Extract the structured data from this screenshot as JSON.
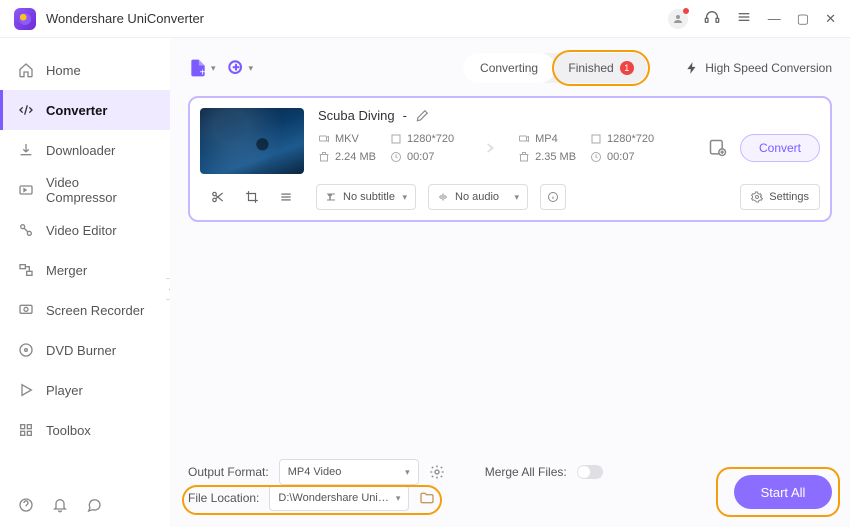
{
  "app": {
    "title": "Wondershare UniConverter"
  },
  "sidebar": {
    "items": [
      {
        "label": "Home"
      },
      {
        "label": "Converter"
      },
      {
        "label": "Downloader"
      },
      {
        "label": "Video Compressor"
      },
      {
        "label": "Video Editor"
      },
      {
        "label": "Merger"
      },
      {
        "label": "Screen Recorder"
      },
      {
        "label": "DVD Burner"
      },
      {
        "label": "Player"
      },
      {
        "label": "Toolbox"
      }
    ]
  },
  "tabs": {
    "converting": "Converting",
    "finished": "Finished",
    "finished_count": "1"
  },
  "hsc": "High Speed Conversion",
  "item": {
    "title": "Scuba Diving",
    "dash": "-",
    "src": {
      "format": "MKV",
      "resolution": "1280*720",
      "size": "2.24 MB",
      "duration": "00:07"
    },
    "dst": {
      "format": "MP4",
      "resolution": "1280*720",
      "size": "2.35 MB",
      "duration": "00:07"
    },
    "subtitle": "No subtitle",
    "audio": "No audio",
    "settings": "Settings",
    "convert": "Convert"
  },
  "footer": {
    "output_format_label": "Output Format:",
    "output_format_value": "MP4 Video",
    "file_location_label": "File Location:",
    "file_location_value": "D:\\Wondershare UniConverter",
    "merge_label": "Merge All Files:",
    "start_all": "Start All"
  }
}
